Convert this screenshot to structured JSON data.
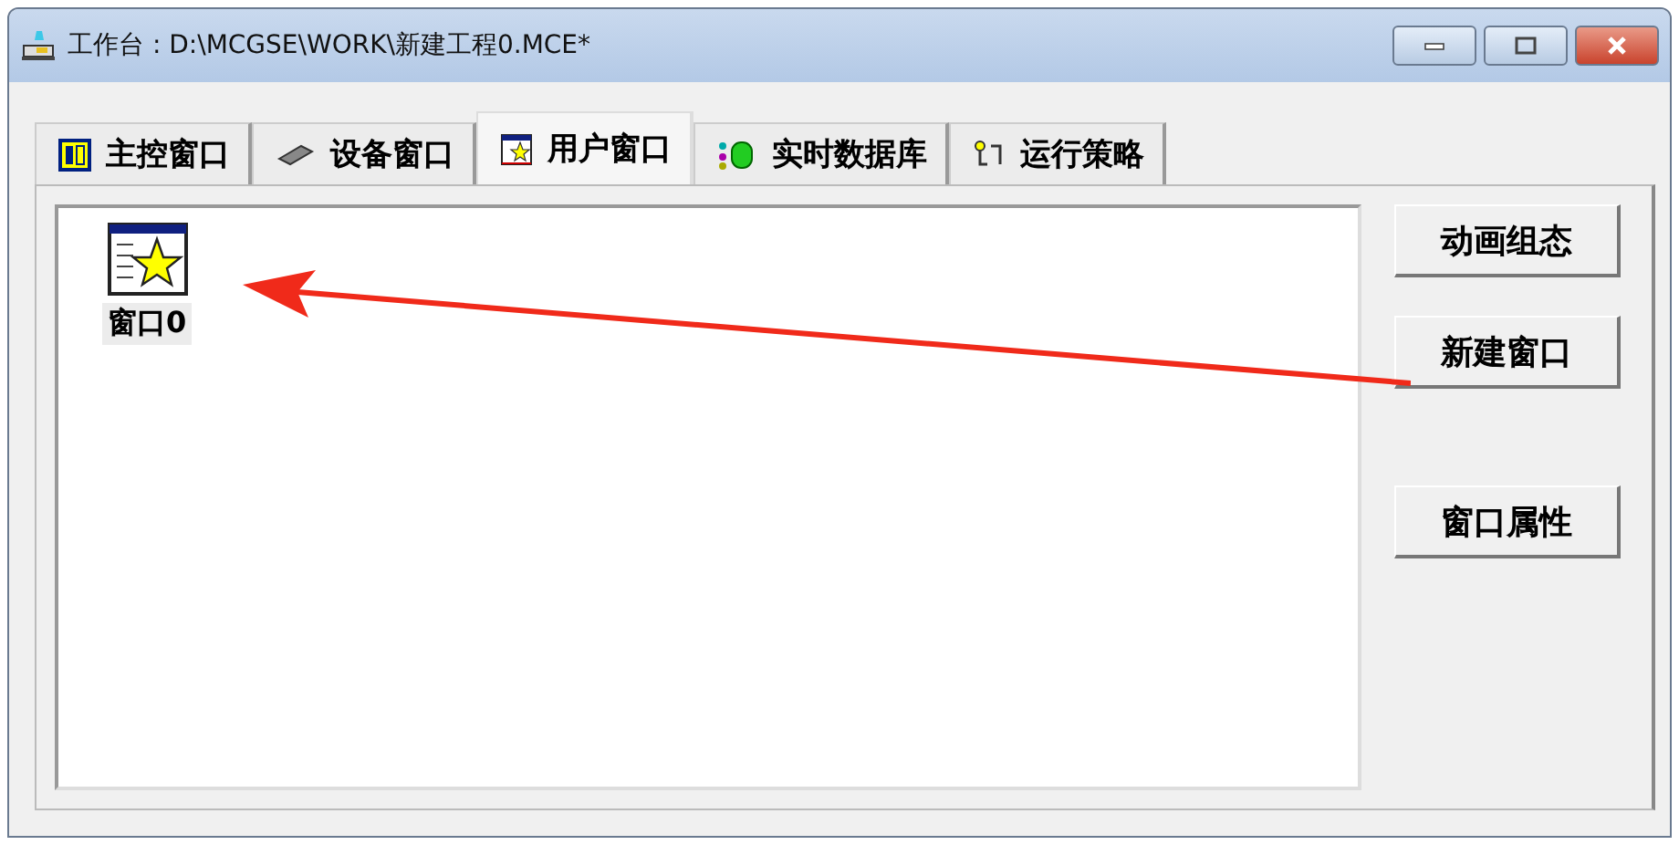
{
  "window": {
    "title": "工作台 : D:\\MCGSE\\WORK\\新建工程0.MCE*"
  },
  "tabs": [
    {
      "label": "主控窗口",
      "kind": "main",
      "selected": false
    },
    {
      "label": "设备窗口",
      "kind": "device",
      "selected": false
    },
    {
      "label": "用户窗口",
      "kind": "user",
      "selected": true
    },
    {
      "label": "实时数据库",
      "kind": "database",
      "selected": false
    },
    {
      "label": "运行策略",
      "kind": "strategy",
      "selected": false
    }
  ],
  "items": [
    {
      "label": "窗口0",
      "selected": true
    }
  ],
  "buttons": [
    "动画组态",
    "新建窗口",
    "窗口属性"
  ]
}
